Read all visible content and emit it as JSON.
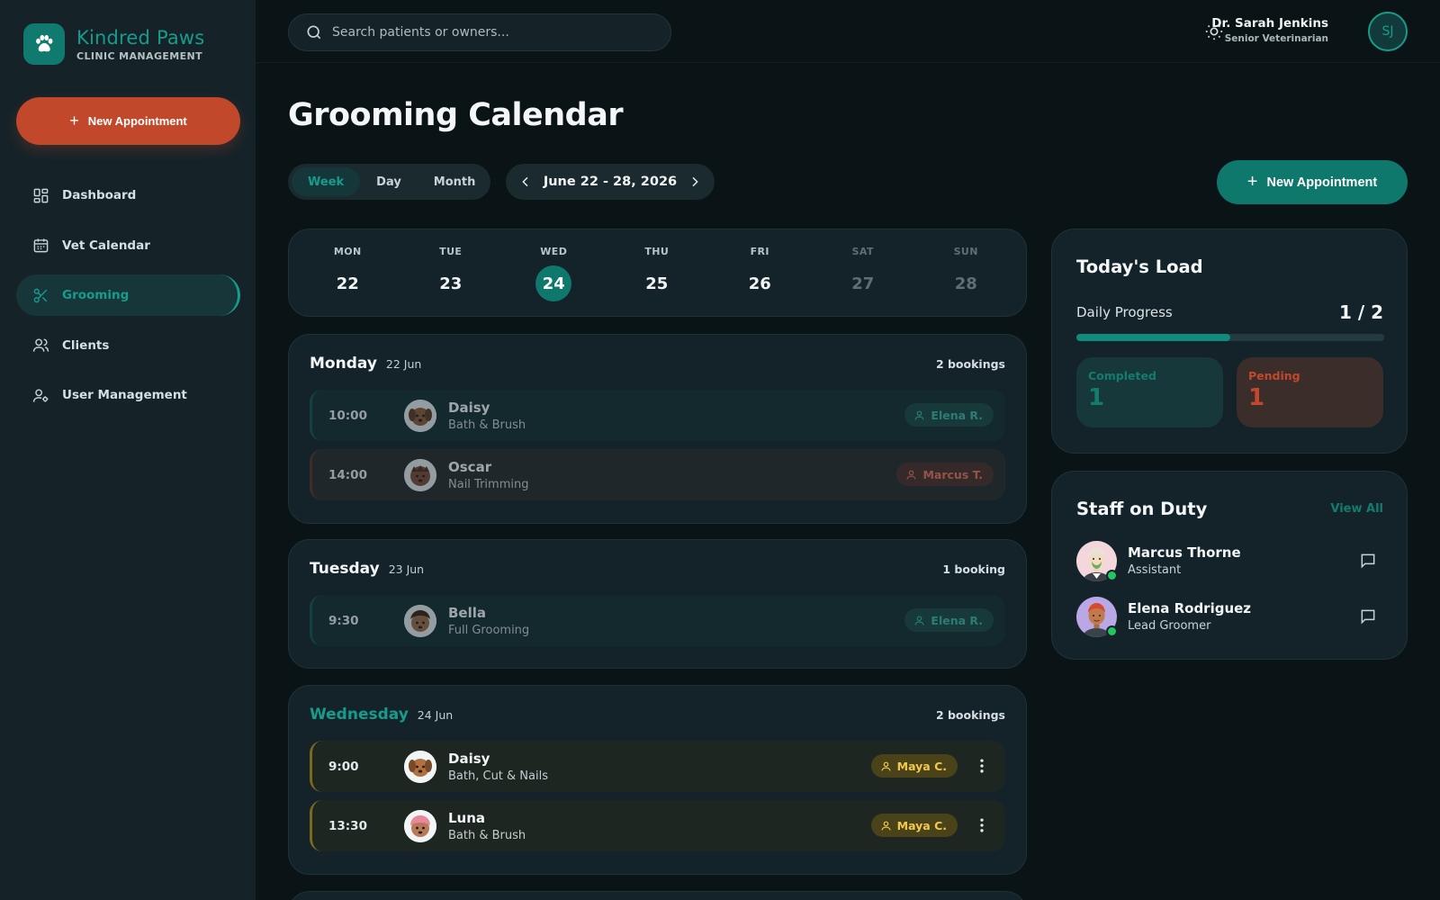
{
  "brand": {
    "name": "Kindred Paws",
    "subtitle": "CLINIC MANAGEMENT",
    "logo_icon": "paw-icon"
  },
  "sidebar": {
    "new_button": "New Appointment",
    "items": [
      {
        "label": "Dashboard",
        "icon": "dashboard-icon",
        "active": false
      },
      {
        "label": "Vet Calendar",
        "icon": "calendar-icon",
        "active": false
      },
      {
        "label": "Grooming",
        "icon": "scissors-icon",
        "active": true
      },
      {
        "label": "Clients",
        "icon": "users-icon",
        "active": false
      },
      {
        "label": "User Management",
        "icon": "user-settings-icon",
        "active": false
      }
    ]
  },
  "topbar": {
    "search_placeholder": "Search patients or owners...",
    "user_name": "Dr. Sarah Jenkins",
    "user_role": "Senior Veterinarian",
    "user_initials": "SJ"
  },
  "page": {
    "title": "Grooming Calendar",
    "views": [
      "Week",
      "Day",
      "Month"
    ],
    "active_view": "Week",
    "date_range": "June 22 - 28, 2026",
    "new_button": "New Appointment"
  },
  "week": [
    {
      "name": "MON",
      "num": "22"
    },
    {
      "name": "TUE",
      "num": "23"
    },
    {
      "name": "WED",
      "num": "24",
      "today": true
    },
    {
      "name": "THU",
      "num": "25"
    },
    {
      "name": "FRI",
      "num": "26"
    },
    {
      "name": "SAT",
      "num": "27",
      "weekend": true
    },
    {
      "name": "SUN",
      "num": "28",
      "weekend": true
    }
  ],
  "days": [
    {
      "name": "Monday",
      "date": "22 Jun",
      "count": "2 bookings",
      "appointments": [
        {
          "time": "10:00",
          "pet": "Daisy",
          "service": "Bath & Brush",
          "staff": "Elena R.",
          "tone": "teal"
        },
        {
          "time": "14:00",
          "pet": "Oscar",
          "service": "Nail Trimming",
          "staff": "Marcus T.",
          "tone": "red"
        }
      ]
    },
    {
      "name": "Tuesday",
      "date": "23 Jun",
      "count": "1 booking",
      "appointments": [
        {
          "time": "9:30",
          "pet": "Bella",
          "service": "Full Grooming",
          "staff": "Elena R.",
          "tone": "teal"
        }
      ]
    },
    {
      "name": "Wednesday",
      "date": "24 Jun",
      "count": "2 bookings",
      "appointments": [
        {
          "time": "9:00",
          "pet": "Daisy",
          "service": "Bath, Cut & Nails",
          "staff": "Maya C.",
          "tone": "gold"
        },
        {
          "time": "13:30",
          "pet": "Luna",
          "service": "Bath & Brush",
          "staff": "Maya C.",
          "tone": "gold"
        }
      ]
    }
  ],
  "load": {
    "title": "Today's Load",
    "progress_label": "Daily Progress",
    "progress_text": "1 / 2",
    "progress_fraction": 0.5,
    "completed_label": "Completed",
    "completed_value": "1",
    "pending_label": "Pending",
    "pending_value": "1"
  },
  "staff": {
    "title": "Staff on Duty",
    "view_all": "View All",
    "members": [
      {
        "name": "Marcus Thorne",
        "role": "Assistant",
        "online": true
      },
      {
        "name": "Elena Rodriguez",
        "role": "Lead Groomer",
        "online": true
      }
    ]
  },
  "colors": {
    "accent": "#0f786c",
    "accent_text": "#179c8c",
    "brand_orange": "#c2482c",
    "gold": "#f2c94c",
    "online": "#22c55e"
  }
}
